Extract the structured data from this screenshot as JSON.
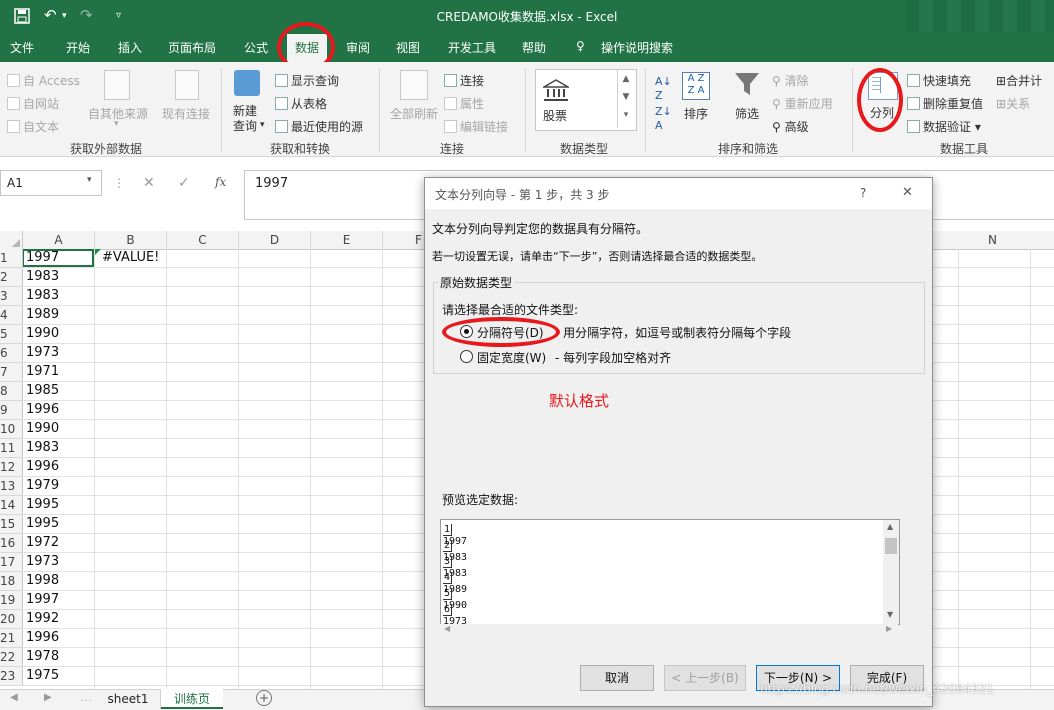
{
  "window": {
    "title": "CREDAMO收集数据.xlsx  -  Excel"
  },
  "quick_access": {
    "save": "save-icon",
    "undo": "↶",
    "redo": "↷"
  },
  "tabs": [
    "文件",
    "开始",
    "插入",
    "页面布局",
    "公式",
    "数据",
    "审阅",
    "视图",
    "开发工具",
    "帮助"
  ],
  "tell_me": "操作说明搜索",
  "ribbon": {
    "get_external": {
      "items": [
        "自 Access",
        "自网站",
        "自文本",
        "自其他来源",
        "现有连接"
      ],
      "label": "获取外部数据"
    },
    "get_transform": {
      "new_query": "新建\n查询",
      "items": [
        "显示查询",
        "从表格",
        "最近使用的源"
      ],
      "label": "获取和转换"
    },
    "connections": {
      "refresh_all": "全部刷新",
      "items": [
        "连接",
        "属性",
        "编辑链接"
      ],
      "label": "连接"
    },
    "data_types": {
      "stocks": "股票",
      "label": "数据类型"
    },
    "sort_filter": {
      "sort": "排序",
      "filter": "筛选",
      "items": [
        "清除",
        "重新应用",
        "高级"
      ],
      "label": "排序和筛选"
    },
    "data_tools": {
      "text_to_columns": "分列",
      "items": [
        "快速填充",
        "删除重复值",
        "数据验证",
        "合并计",
        "关系"
      ],
      "label": "数据工具"
    }
  },
  "formula_bar": {
    "name_box": "A1",
    "cancel": "✕",
    "enter": "✓",
    "fx": "fx",
    "value": "1997"
  },
  "grid": {
    "columns": [
      "A",
      "B",
      "C",
      "D",
      "E",
      "F",
      "N"
    ],
    "rows": [
      {
        "n": "1",
        "a": "1997",
        "b": "#VALUE!"
      },
      {
        "n": "2",
        "a": "1983",
        "b": ""
      },
      {
        "n": "3",
        "a": "1983",
        "b": ""
      },
      {
        "n": "4",
        "a": "1989",
        "b": ""
      },
      {
        "n": "5",
        "a": "1990",
        "b": ""
      },
      {
        "n": "6",
        "a": "1973",
        "b": ""
      },
      {
        "n": "7",
        "a": "1971",
        "b": ""
      },
      {
        "n": "8",
        "a": "1985",
        "b": ""
      },
      {
        "n": "9",
        "a": "1996",
        "b": ""
      },
      {
        "n": "10",
        "a": "1990",
        "b": ""
      },
      {
        "n": "11",
        "a": "1983",
        "b": ""
      },
      {
        "n": "12",
        "a": "1996",
        "b": ""
      },
      {
        "n": "13",
        "a": "1979",
        "b": ""
      },
      {
        "n": "14",
        "a": "1995",
        "b": ""
      },
      {
        "n": "15",
        "a": "1995",
        "b": ""
      },
      {
        "n": "16",
        "a": "1972",
        "b": ""
      },
      {
        "n": "17",
        "a": "1973",
        "b": ""
      },
      {
        "n": "18",
        "a": "1998",
        "b": ""
      },
      {
        "n": "19",
        "a": "1997",
        "b": ""
      },
      {
        "n": "20",
        "a": "1992",
        "b": ""
      },
      {
        "n": "21",
        "a": "1996",
        "b": ""
      },
      {
        "n": "22",
        "a": "1978",
        "b": ""
      },
      {
        "n": "23",
        "a": "1975",
        "b": ""
      }
    ]
  },
  "sheets": {
    "items": [
      "sheet1",
      "训练页"
    ],
    "active": "训练页",
    "add": "+"
  },
  "dialog": {
    "title": "文本分列向导 - 第 1 步，共 3 步",
    "help": "?",
    "close": "✕",
    "line1": "文本分列向导判定您的数据具有分隔符。",
    "line2": "若一切设置无误，请单击“下一步”，否则请选择最合适的数据类型。",
    "group_title": "原始数据类型",
    "prompt": "请选择最合适的文件类型:",
    "opt1": {
      "label": "分隔符号(D)",
      "desc": "- 用分隔字符，如逗号或制表符分隔每个字段",
      "selected": true
    },
    "opt2": {
      "label": "固定宽度(W)",
      "desc": "- 每列字段加空格对齐",
      "selected": false
    },
    "annotation": "默认格式",
    "preview_label": "预览选定数据:",
    "preview_rows": [
      {
        "n": "1",
        "v": "1997"
      },
      {
        "n": "2",
        "v": "1983"
      },
      {
        "n": "3",
        "v": "1983"
      },
      {
        "n": "4",
        "v": "1989"
      },
      {
        "n": "5",
        "v": "1990"
      },
      {
        "n": "6",
        "v": "1973"
      }
    ],
    "buttons": {
      "cancel": "取消",
      "back": "< 上一步(B)",
      "next": "下一步(N) >",
      "finish": "完成(F)"
    }
  },
  "watermark": "https://blog.csdn.net/weixin_42084321",
  "colors": {
    "excel_green": "#217346",
    "annotation_red": "#e8191c"
  }
}
